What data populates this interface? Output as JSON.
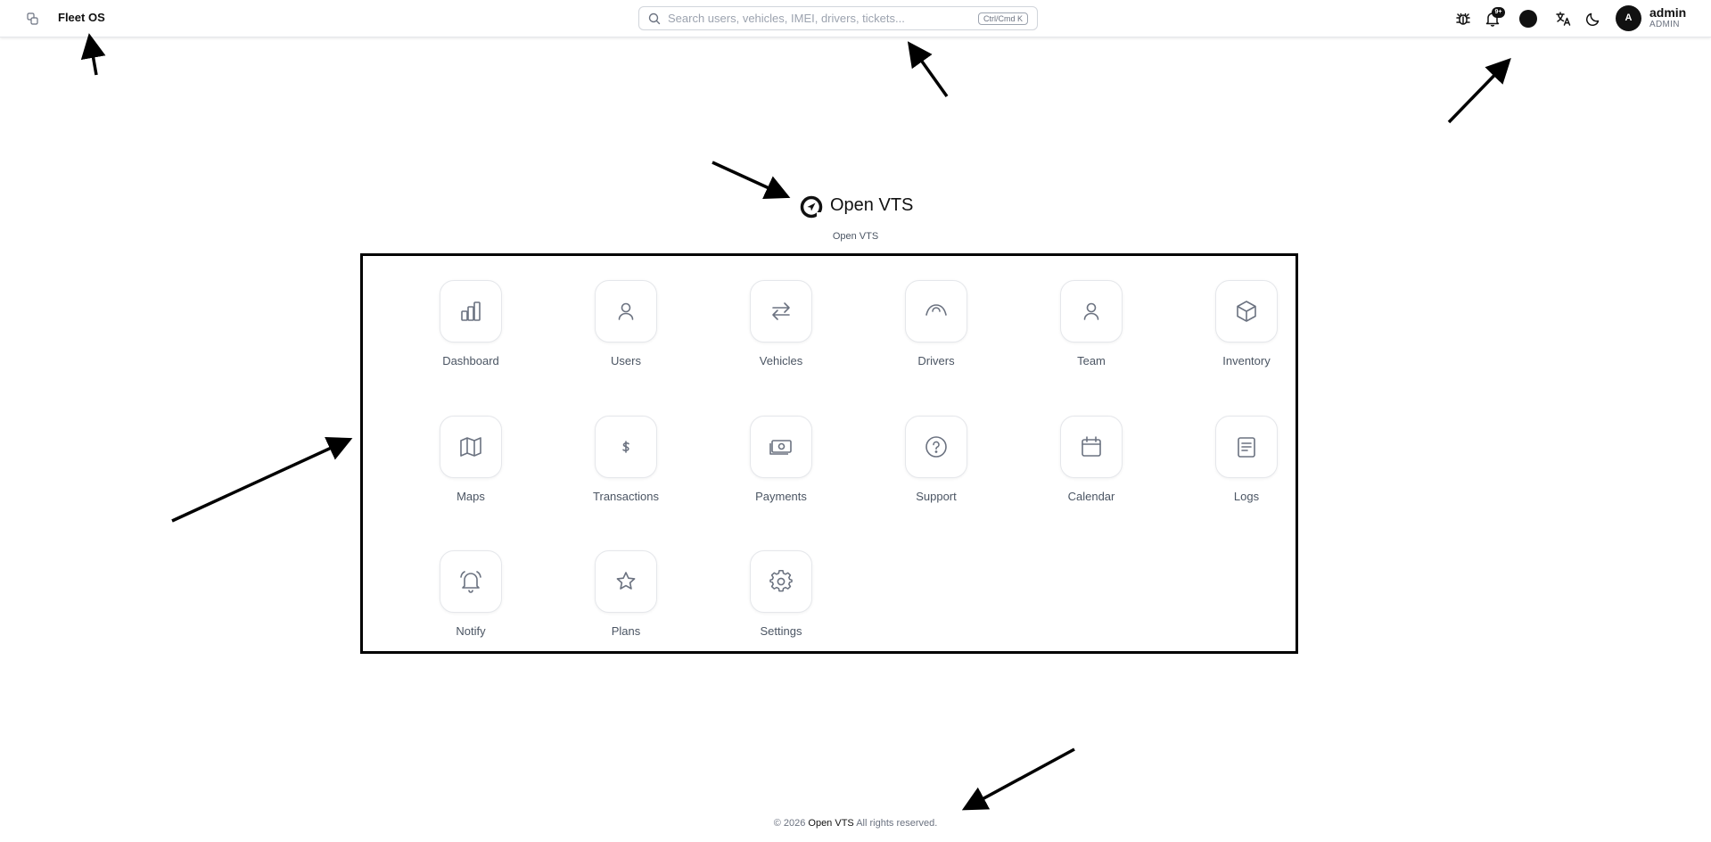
{
  "header": {
    "brand": "Fleet OS",
    "search_placeholder": "Search users, vehicles, IMEI, drivers, tickets...",
    "search_shortcut": "Ctrl/Cmd K",
    "notification_count": "9+",
    "user": {
      "initial": "A",
      "name": "admin",
      "role": "ADMIN"
    },
    "icons": [
      "sidebar-toggle-icon",
      "search-icon",
      "bug-icon",
      "bell-icon",
      "theme-color-icon",
      "translate-icon",
      "moon-icon"
    ]
  },
  "logo": {
    "text": "Open VTS",
    "subtitle": "Open VTS"
  },
  "apps": [
    {
      "label": "Dashboard",
      "icon": "bar-chart-icon"
    },
    {
      "label": "Users",
      "icon": "user-icon"
    },
    {
      "label": "Vehicles",
      "icon": "arrows-swap-icon"
    },
    {
      "label": "Drivers",
      "icon": "steering-wheel-icon"
    },
    {
      "label": "Team",
      "icon": "user-icon"
    },
    {
      "label": "Inventory",
      "icon": "box-icon"
    },
    {
      "label": "Maps",
      "icon": "map-icon"
    },
    {
      "label": "Transactions",
      "icon": "dollar-icon"
    },
    {
      "label": "Payments",
      "icon": "banknote-icon"
    },
    {
      "label": "Support",
      "icon": "help-circle-icon"
    },
    {
      "label": "Calendar",
      "icon": "calendar-icon"
    },
    {
      "label": "Logs",
      "icon": "file-text-icon"
    },
    {
      "label": "Notify",
      "icon": "bell-ring-icon"
    },
    {
      "label": "Plans",
      "icon": "star-icon"
    },
    {
      "label": "Settings",
      "icon": "gear-icon"
    }
  ],
  "footer": {
    "copyright": "© 2026",
    "brand": "Open VTS",
    "rights": "All rights reserved."
  }
}
